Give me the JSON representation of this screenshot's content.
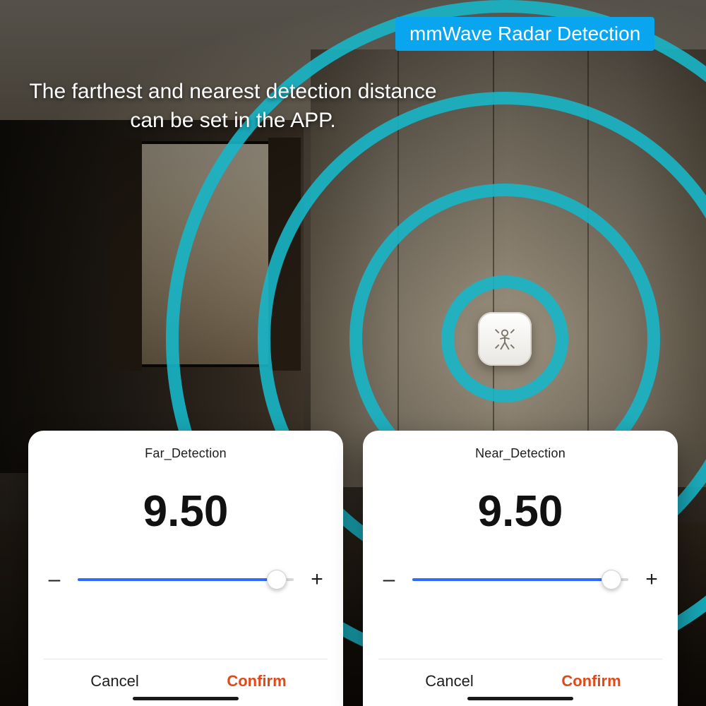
{
  "badge": {
    "text": "mmWave Radar Detection"
  },
  "headline": "The farthest and nearest detection distance can be set in the APP.",
  "colors": {
    "accent": "#0aa5ef",
    "ring": "#17b6c8",
    "slider": "#2f6bff",
    "confirm": "#e04a18"
  },
  "cards": [
    {
      "title": "Far_Detection",
      "value": "9.50",
      "slider": {
        "min": 0,
        "max": 10,
        "position_pct": 92,
        "minus": "–",
        "plus": "+"
      },
      "actions": {
        "cancel": "Cancel",
        "confirm": "Confirm"
      }
    },
    {
      "title": "Near_Detection",
      "value": "9.50",
      "slider": {
        "min": 0,
        "max": 10,
        "position_pct": 92,
        "minus": "–",
        "plus": "+"
      },
      "actions": {
        "cancel": "Cancel",
        "confirm": "Confirm"
      }
    }
  ],
  "sensor": {
    "icon": "person-radar-icon"
  }
}
